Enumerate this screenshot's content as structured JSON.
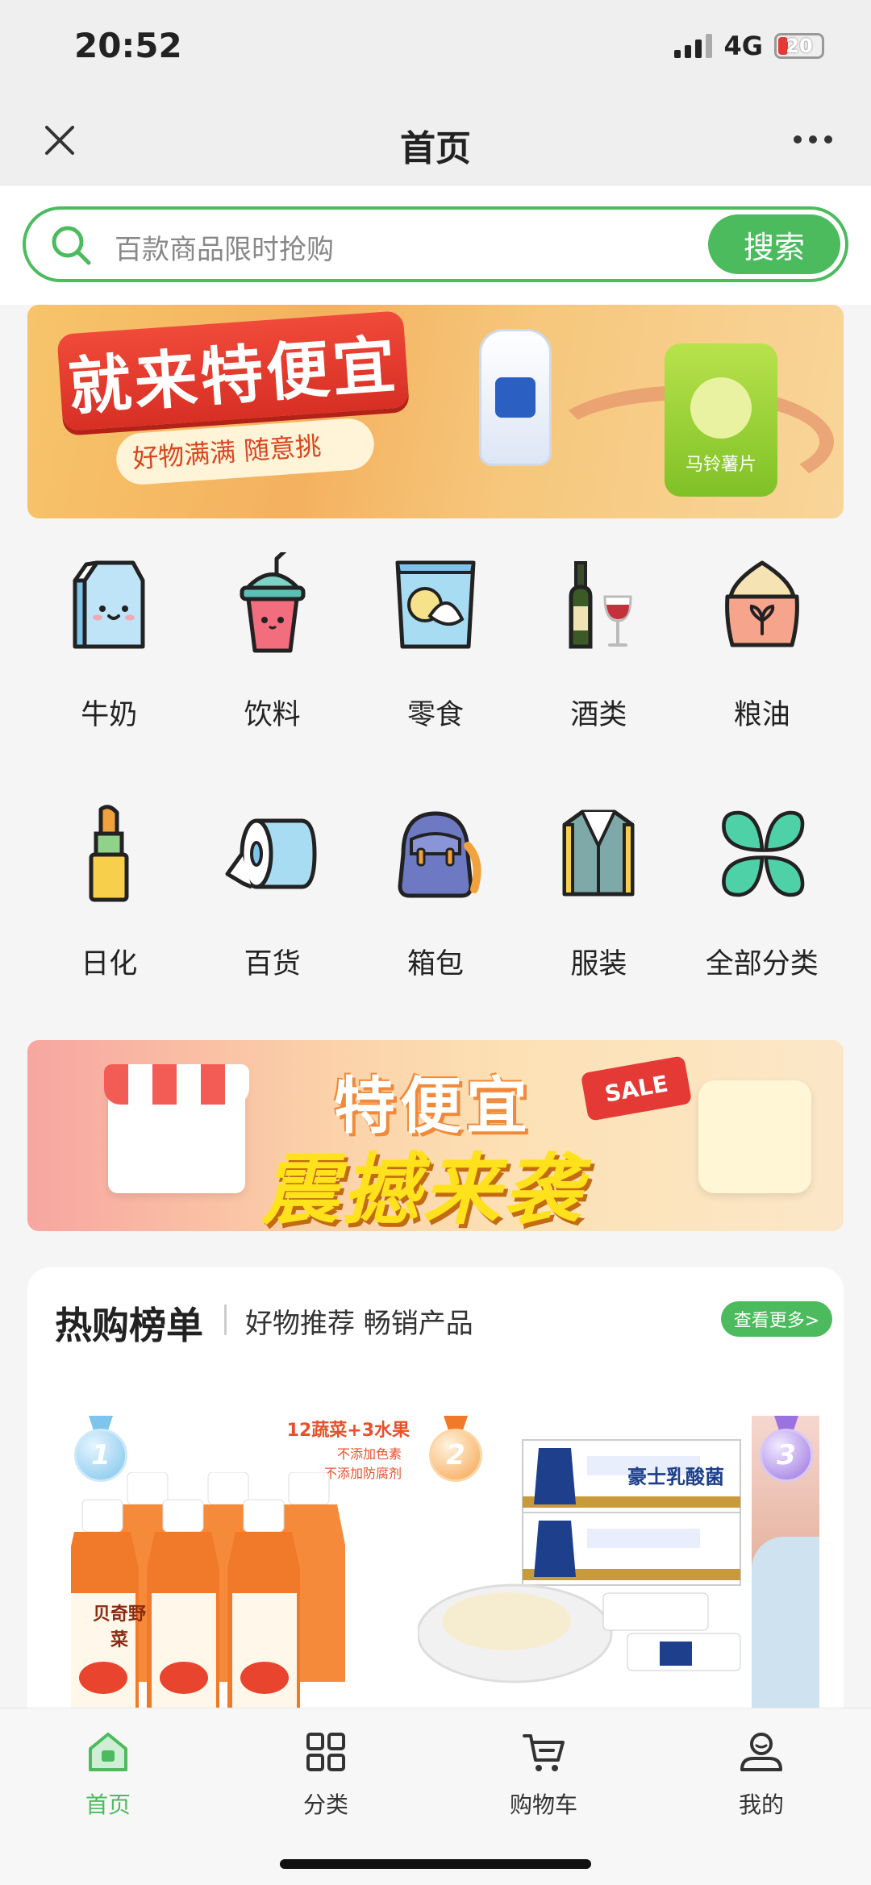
{
  "status": {
    "time": "20:52",
    "network": "4G",
    "battery": "20"
  },
  "nav": {
    "title": "首页",
    "close_icon": "close-icon",
    "more_icon": "more-dots-icon"
  },
  "search": {
    "placeholder": "百款商品限时抢购",
    "button_label": "搜索",
    "icon": "search-icon",
    "accent": "#4cbb5e"
  },
  "banner_top": {
    "title": "就来特便宜",
    "subtitle": "好物满满 随意挑",
    "chips_label": "马铃薯片"
  },
  "categories": [
    {
      "label": "牛奶",
      "icon": "milk-carton-icon"
    },
    {
      "label": "饮料",
      "icon": "drink-cup-icon"
    },
    {
      "label": "零食",
      "icon": "snack-bag-icon"
    },
    {
      "label": "酒类",
      "icon": "wine-icon"
    },
    {
      "label": "粮油",
      "icon": "grain-sack-icon"
    },
    {
      "label": "日化",
      "icon": "lipstick-icon"
    },
    {
      "label": "百货",
      "icon": "tissue-roll-icon"
    },
    {
      "label": "箱包",
      "icon": "backpack-icon"
    },
    {
      "label": "服装",
      "icon": "suit-jacket-icon"
    },
    {
      "label": "全部分类",
      "icon": "clover-icon"
    }
  ],
  "banner_mid": {
    "title_line1": "特便宜",
    "title_line2": "震撼来袭",
    "sale_tag": "SALE"
  },
  "hot_list": {
    "title": "热购榜单",
    "subtitle": "好物推荐 畅销产品",
    "more_label": "查看更多>",
    "products": [
      {
        "rank": "1",
        "brand": "贝奇野菜",
        "tagline": "12蔬菜+3水果",
        "features": [
          "不添加色素",
          "不添加防腐剂"
        ],
        "medal_color": "#7ec4ec"
      },
      {
        "rank": "2",
        "brand": "豪士乳酸菌",
        "medal_color": "#f5a44e"
      },
      {
        "rank": "3",
        "medal_color": "#9b73e0"
      }
    ]
  },
  "tabs": [
    {
      "label": "首页",
      "icon": "home-icon",
      "active": true
    },
    {
      "label": "分类",
      "icon": "grid-icon",
      "active": false
    },
    {
      "label": "购物车",
      "icon": "cart-icon",
      "active": false
    },
    {
      "label": "我的",
      "icon": "user-icon",
      "active": false
    }
  ]
}
